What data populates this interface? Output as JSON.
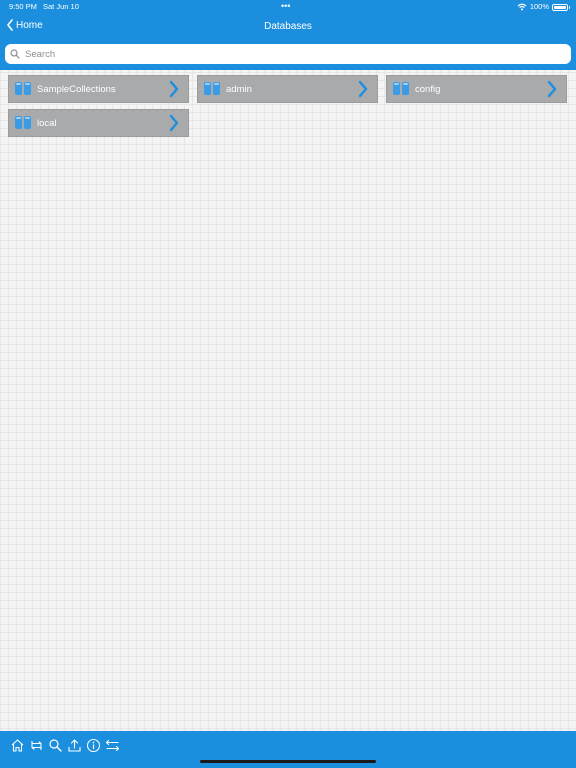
{
  "status_bar": {
    "time": "9:50 PM",
    "date": "Sat Jun 10",
    "dots": "•••",
    "battery_percent": "100%"
  },
  "nav": {
    "back_label": "Home",
    "title": "Databases"
  },
  "search": {
    "placeholder": "Search"
  },
  "databases": [
    {
      "name": "SampleCollections"
    },
    {
      "name": "admin"
    },
    {
      "name": "config"
    },
    {
      "name": "local"
    }
  ],
  "toolbar": {
    "icons": [
      "home-icon",
      "refresh-icon",
      "search-icon",
      "upload-icon",
      "info-icon",
      "transfer-icon"
    ]
  },
  "colors": {
    "accent": "#1b8fde",
    "item_background": "#a9aaac",
    "icon_blue": "#3a9be6"
  }
}
